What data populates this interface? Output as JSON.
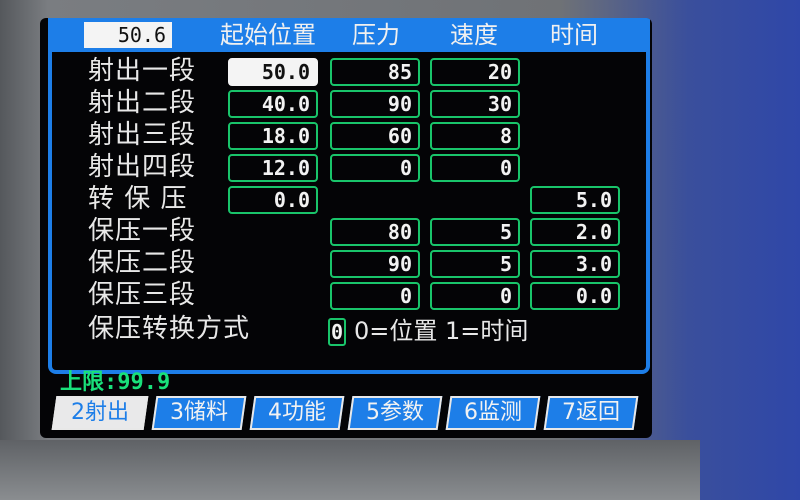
{
  "position_display": "50.6",
  "headers": {
    "start_pos": "起始位置",
    "pressure": "压力",
    "speed": "速度",
    "time": "时间"
  },
  "rows": [
    {
      "label": "射出一段",
      "pos": "50.0",
      "pressure": "85",
      "speed": "20",
      "time": ""
    },
    {
      "label": "射出二段",
      "pos": "40.0",
      "pressure": "90",
      "speed": "30",
      "time": ""
    },
    {
      "label": "射出三段",
      "pos": "18.0",
      "pressure": "60",
      "speed": "8",
      "time": ""
    },
    {
      "label": "射出四段",
      "pos": "12.0",
      "pressure": "0",
      "speed": "0",
      "time": ""
    },
    {
      "label": "转 保 压",
      "pos": "0.0",
      "pressure": "",
      "speed": "",
      "time": "5.0"
    },
    {
      "label": "保压一段",
      "pos": "",
      "pressure": "80",
      "speed": "5",
      "time": "2.0"
    },
    {
      "label": "保压二段",
      "pos": "",
      "pressure": "90",
      "speed": "5",
      "time": "3.0"
    },
    {
      "label": "保压三段",
      "pos": "",
      "pressure": "0",
      "speed": "0",
      "time": "0.0"
    }
  ],
  "switch_mode": {
    "label": "保压转换方式",
    "value": "0",
    "options_text": "0=位置  1=时间"
  },
  "upper_limit": "上限:99.9",
  "function_keys": [
    {
      "label": "2射出",
      "active": true
    },
    {
      "label": "3储料",
      "active": false
    },
    {
      "label": "4功能",
      "active": false
    },
    {
      "label": "5参数",
      "active": false
    },
    {
      "label": "6监测",
      "active": false
    },
    {
      "label": "7返回",
      "active": false
    }
  ],
  "colors": {
    "accent": "#1d7ee8",
    "field_border": "#19c46a",
    "limit_text": "#19e07a",
    "screen_bg": "#040406"
  }
}
